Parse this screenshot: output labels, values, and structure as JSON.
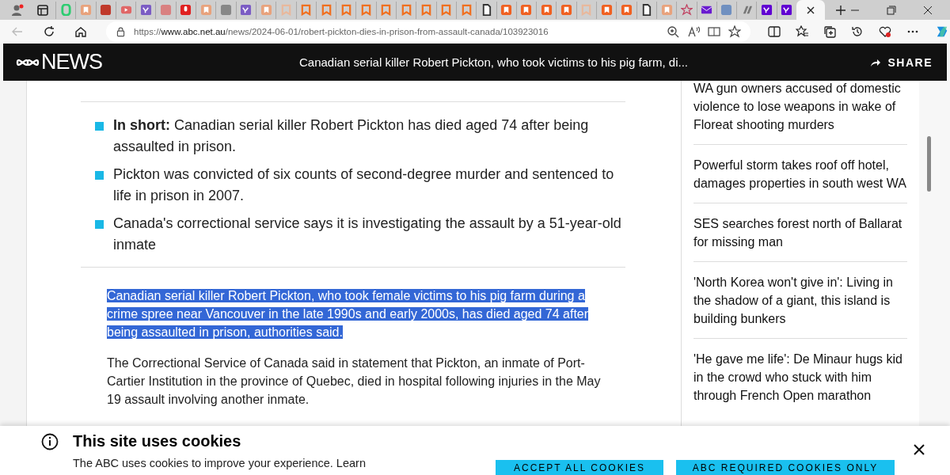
{
  "browser": {
    "tabs": [
      {
        "kind": "g",
        "color": "#2ecc71"
      },
      {
        "kind": "bookmark",
        "color": "#e8a27c"
      },
      {
        "kind": "bi",
        "color": "#c0392b"
      },
      {
        "kind": "play",
        "color": "#e06666"
      },
      {
        "kind": "yahoo",
        "color": "#7b5cc4"
      },
      {
        "kind": "r",
        "color": "#d98080"
      },
      {
        "kind": "mic",
        "color": "#e02020"
      },
      {
        "kind": "bookmark",
        "color": "#e8a27c"
      },
      {
        "kind": "a",
        "color": "#888888"
      },
      {
        "kind": "yahoo",
        "color": "#7b5cc4"
      },
      {
        "kind": "bookmark",
        "color": "#e8a27c"
      },
      {
        "kind": "ribbon",
        "color": "#e8b89c"
      },
      {
        "kind": "ribbon",
        "color": "#f07020"
      },
      {
        "kind": "ribbon",
        "color": "#f07020"
      },
      {
        "kind": "ribbon",
        "color": "#f07020"
      },
      {
        "kind": "ribbon",
        "color": "#f07020"
      },
      {
        "kind": "ribbon",
        "color": "#f07020"
      },
      {
        "kind": "ribbon",
        "color": "#f07020"
      },
      {
        "kind": "ribbon",
        "color": "#f07020"
      },
      {
        "kind": "ribbon",
        "color": "#f07020"
      },
      {
        "kind": "ribbon",
        "color": "#f07020"
      },
      {
        "kind": "page",
        "color": "#333333"
      },
      {
        "kind": "bookmark",
        "color": "#f06020"
      },
      {
        "kind": "bookmark",
        "color": "#f06020"
      },
      {
        "kind": "bookmark",
        "color": "#f06020"
      },
      {
        "kind": "bookmark",
        "color": "#f06020"
      },
      {
        "kind": "ribbon",
        "color": "#e8b89c"
      },
      {
        "kind": "bookmark",
        "color": "#f06020"
      },
      {
        "kind": "bookmark",
        "color": "#f06020"
      },
      {
        "kind": "page",
        "color": "#333333"
      },
      {
        "kind": "bookmark",
        "color": "#e8a27c"
      },
      {
        "kind": "star",
        "color": "#c04060"
      },
      {
        "kind": "mail",
        "color": "#6a1bd0"
      },
      {
        "kind": "m",
        "color": "#7090c0"
      },
      {
        "kind": "slash",
        "color": "#777777"
      },
      {
        "kind": "yahoo",
        "color": "#6001d2"
      },
      {
        "kind": "yahoo",
        "color": "#6001d2"
      }
    ],
    "url_host": "www.abc.net.au",
    "url_scheme": "https://",
    "url_path": "/news/2024-06-01/robert-pickton-dies-in-prison-from-assault-canada/103923016"
  },
  "header": {
    "logo": "NEWS",
    "title": "Canadian serial killer Robert Pickton, who took victims to his pig farm, di...",
    "share": "SHARE"
  },
  "article": {
    "key_points": [
      "**In short:** Canadian serial killer Robert Pickton has died aged 74 after being assaulted in prison.",
      "Pickton was convicted of six counts of second-degree murder and sentenced to life in prison in 2007.",
      "Canada's correctional service says it is investigating the assault by a 51-year-old inmate"
    ],
    "paragraphs": [
      {
        "text": "Canadian serial killer Robert Pickton, who took female victims to his pig farm during a crime spree near Vancouver in the late 1990s and early 2000s, has died aged 74 after being assaulted in prison, authorities said.",
        "selected": true
      },
      {
        "text": "The Correctional Service of Canada said in statement that Pickton, an inmate of Port-Cartier Institution in the province of Quebec, died in hospital following injuries in the May 19 assault involving another inmate.",
        "selected": false
      }
    ]
  },
  "sidebar": {
    "links": [
      "WA gun owners accused of domestic violence to lose weapons in wake of Floreat shooting murders",
      "Powerful storm takes roof off hotel, damages properties in south west WA",
      "SES searches forest north of Ballarat for missing man",
      "'North Korea won't give in': Living in the shadow of a giant, this island is building bunkers",
      "'He gave me life': De Minaur hugs kid in the crowd who stuck with him through French Open marathon"
    ]
  },
  "cookie_banner": {
    "title": "This site uses cookies",
    "text": "The ABC uses cookies to improve your experience. Learn",
    "buttons": [
      "ACCEPT ALL COOKIES",
      "ABC REQUIRED COOKIES ONLY"
    ]
  }
}
